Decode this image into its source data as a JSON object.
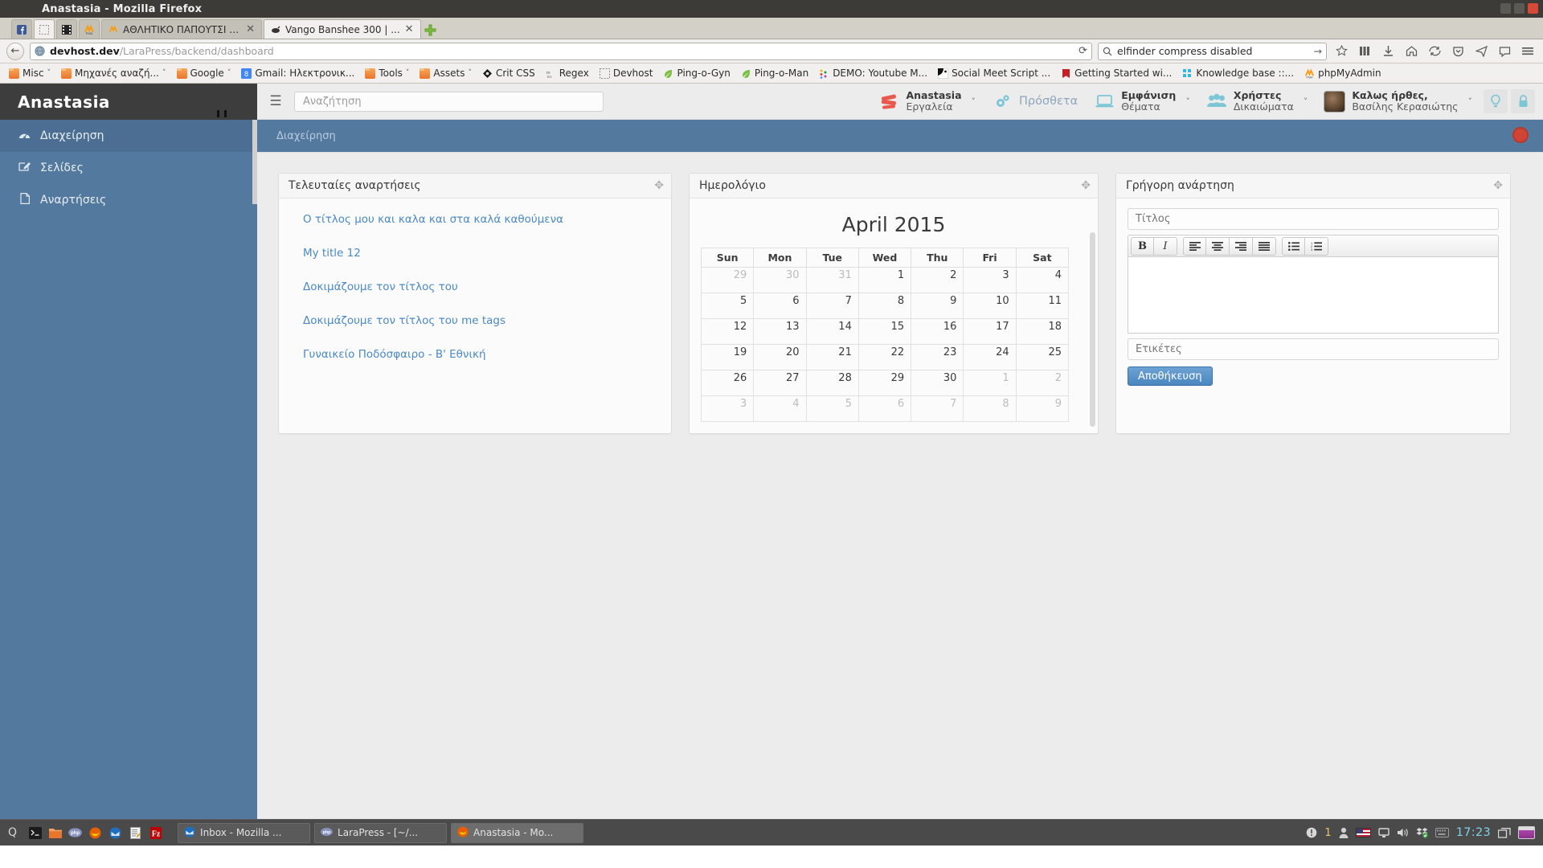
{
  "browser": {
    "window_title": "Anastasia - Mozilla Firefox",
    "tabs": [
      {
        "label": "ΑΘΛΗΤΙΚΟ ΠΑΠΟΥΤΣΙ ΠΟΔ...",
        "close": "✕",
        "active": false
      },
      {
        "label": "Vango Banshee 300 | ...",
        "close": "✕",
        "active": true
      }
    ],
    "new_tab": "+",
    "url_host": "devhost.dev",
    "url_path": "/LaraPress/backend/dashboard",
    "search_value": "elfinder compress disabled",
    "back_icon": "←",
    "reload_icon": "⟳",
    "go_icon": "→",
    "bookmarks": [
      {
        "label": "Misc",
        "chev": "˅",
        "icon": "folder"
      },
      {
        "label": "Μηχανές αναζή...",
        "chev": "˅",
        "icon": "folder"
      },
      {
        "label": "Google",
        "chev": "˅",
        "icon": "folder"
      },
      {
        "label": "Gmail: Ηλεκτρονικ...",
        "chev": "",
        "icon": "gmail"
      },
      {
        "label": "Tools",
        "chev": "˅",
        "icon": "folder"
      },
      {
        "label": "Assets",
        "chev": "˅",
        "icon": "folder"
      },
      {
        "label": "Crit CSS",
        "chev": "",
        "icon": "diamond"
      },
      {
        "label": "Regex",
        "chev": "",
        "icon": "regex"
      },
      {
        "label": "Devhost",
        "chev": "",
        "icon": "blank"
      },
      {
        "label": "Ping-o-Gyn",
        "chev": "",
        "icon": "leaf"
      },
      {
        "label": "Ping-o-Man",
        "chev": "",
        "icon": "leaf"
      },
      {
        "label": "DEMO: Youtube M...",
        "chev": "",
        "icon": "dots"
      },
      {
        "label": "Social Meet Script ...",
        "chev": "",
        "icon": "mask"
      },
      {
        "label": "Getting Started wi...",
        "chev": "",
        "icon": "red"
      },
      {
        "label": "Knowledge base ::...",
        "chev": "",
        "icon": "cyan"
      },
      {
        "label": "phpMyAdmin",
        "chev": "",
        "icon": "pma"
      }
    ],
    "toolbar_icons": [
      "star-icon",
      "library-icon",
      "downloads-icon",
      "home-icon",
      "sync-icon",
      "pocket-icon",
      "send-icon",
      "feedback-icon",
      "menu-icon"
    ]
  },
  "app": {
    "brand": "Anastasia",
    "sidebar": [
      {
        "label": "Διαχείρηση",
        "icon": "dashboard",
        "active": true
      },
      {
        "label": "Σελίδες",
        "icon": "pencil-square",
        "active": false
      },
      {
        "label": "Αναρτήσεις",
        "icon": "file",
        "active": false
      }
    ],
    "topbar": {
      "burger": "☰",
      "search_placeholder": "Αναζήτηση",
      "nav": [
        {
          "l1": "Anastasia",
          "l2": "Εργαλεία",
          "icon": "tools-stack",
          "caret": "˅"
        },
        {
          "single": "Πρόσθετα",
          "icon": "gears",
          "caret": ""
        },
        {
          "l1": "Εμφάνιση",
          "l2": "Θέματα",
          "icon": "laptop",
          "caret": "˅"
        },
        {
          "l1": "Χρήστες",
          "l2": "Δικαιώματα",
          "icon": "users",
          "caret": "˅"
        },
        {
          "l1": "Καλως ήρθες,",
          "l2": "Βασίλης Κερασιώτης",
          "icon": "avatar",
          "caret": "˅"
        }
      ],
      "action_icons": [
        "lightbulb-icon",
        "lock-icon"
      ]
    },
    "breadcrumb": "Διαχείρηση",
    "panels": {
      "recent_posts": {
        "title": "Τελευταίες αναρτήσεις",
        "move_icon": "✥",
        "items": [
          "Ο τίτλος μου και καλα και στα καλά καθούμενα",
          "My title 12",
          "Δοκιμάζουμε τον τίτλος του",
          "Δοκιμάζουμε τον τίτλος του me tags",
          "Γυναικείο Ποδόσφαιρο - Β' Εθνική"
        ]
      },
      "calendar": {
        "title": "Ημερολόγιο",
        "move_icon": "✥",
        "month_title": "April 2015",
        "weekdays": [
          "Sun",
          "Mon",
          "Tue",
          "Wed",
          "Thu",
          "Fri",
          "Sat"
        ],
        "weeks": [
          [
            {
              "d": "29",
              "m": true
            },
            {
              "d": "30",
              "m": true
            },
            {
              "d": "31",
              "m": true
            },
            {
              "d": "1",
              "m": false
            },
            {
              "d": "2",
              "m": false
            },
            {
              "d": "3",
              "m": false
            },
            {
              "d": "4",
              "m": false
            }
          ],
          [
            {
              "d": "5",
              "m": false
            },
            {
              "d": "6",
              "m": false
            },
            {
              "d": "7",
              "m": false
            },
            {
              "d": "8",
              "m": false
            },
            {
              "d": "9",
              "m": false
            },
            {
              "d": "10",
              "m": false
            },
            {
              "d": "11",
              "m": false
            }
          ],
          [
            {
              "d": "12",
              "m": false
            },
            {
              "d": "13",
              "m": false
            },
            {
              "d": "14",
              "m": false
            },
            {
              "d": "15",
              "m": false
            },
            {
              "d": "16",
              "m": false
            },
            {
              "d": "17",
              "m": false
            },
            {
              "d": "18",
              "m": false
            }
          ],
          [
            {
              "d": "19",
              "m": false
            },
            {
              "d": "20",
              "m": false
            },
            {
              "d": "21",
              "m": false
            },
            {
              "d": "22",
              "m": false
            },
            {
              "d": "23",
              "m": false
            },
            {
              "d": "24",
              "m": false
            },
            {
              "d": "25",
              "m": false
            }
          ],
          [
            {
              "d": "26",
              "m": false
            },
            {
              "d": "27",
              "m": false
            },
            {
              "d": "28",
              "m": false
            },
            {
              "d": "29",
              "m": false
            },
            {
              "d": "30",
              "m": false
            },
            {
              "d": "1",
              "m": true
            },
            {
              "d": "2",
              "m": true
            }
          ],
          [
            {
              "d": "3",
              "m": true
            },
            {
              "d": "4",
              "m": true
            },
            {
              "d": "5",
              "m": true
            },
            {
              "d": "6",
              "m": true
            },
            {
              "d": "7",
              "m": true
            },
            {
              "d": "8",
              "m": true
            },
            {
              "d": "9",
              "m": true
            }
          ]
        ]
      },
      "quick_post": {
        "title": "Γρήγορη ανάρτηση",
        "move_icon": "✥",
        "title_placeholder": "Τίτλος",
        "tags_placeholder": "Ετικέτες",
        "save_label": "Αποθήκευση",
        "toolbar": [
          {
            "name": "bold",
            "glyph": "B"
          },
          {
            "name": "italic",
            "glyph": "I"
          },
          {
            "name": "align-left",
            "glyph": "☰"
          },
          {
            "name": "align-center",
            "glyph": "☰"
          },
          {
            "name": "align-right",
            "glyph": "☰"
          },
          {
            "name": "align-justify",
            "glyph": "☰"
          },
          {
            "name": "unordered-list",
            "glyph": "☰"
          },
          {
            "name": "ordered-list",
            "glyph": "☰"
          }
        ]
      }
    },
    "accent_color": "#54799f",
    "link_color": "#4a89c7"
  },
  "taskbar": {
    "menu_glyph": "Q",
    "launchers": [
      "terminal-icon",
      "files-icon",
      "php-icon",
      "firefox-icon",
      "thunderbird-icon",
      "editor-icon",
      "filezilla-icon"
    ],
    "windows": [
      {
        "label": "Inbox - Mozilla ...",
        "icon": "thunderbird",
        "current": false
      },
      {
        "label": "LaraPress - [~/...",
        "icon": "phpstorm",
        "current": false
      },
      {
        "label": "Anastasia - Mo...",
        "icon": "firefox",
        "current": true
      }
    ],
    "tray": [
      "alert-icon",
      "1",
      "user-icon",
      "flag-icon",
      "display-icon",
      "volume-icon",
      "dropbox-icon",
      "keyboard-icon"
    ],
    "tray_count": "1",
    "clock": "17:23",
    "workspace_icon": "windows-icon"
  }
}
